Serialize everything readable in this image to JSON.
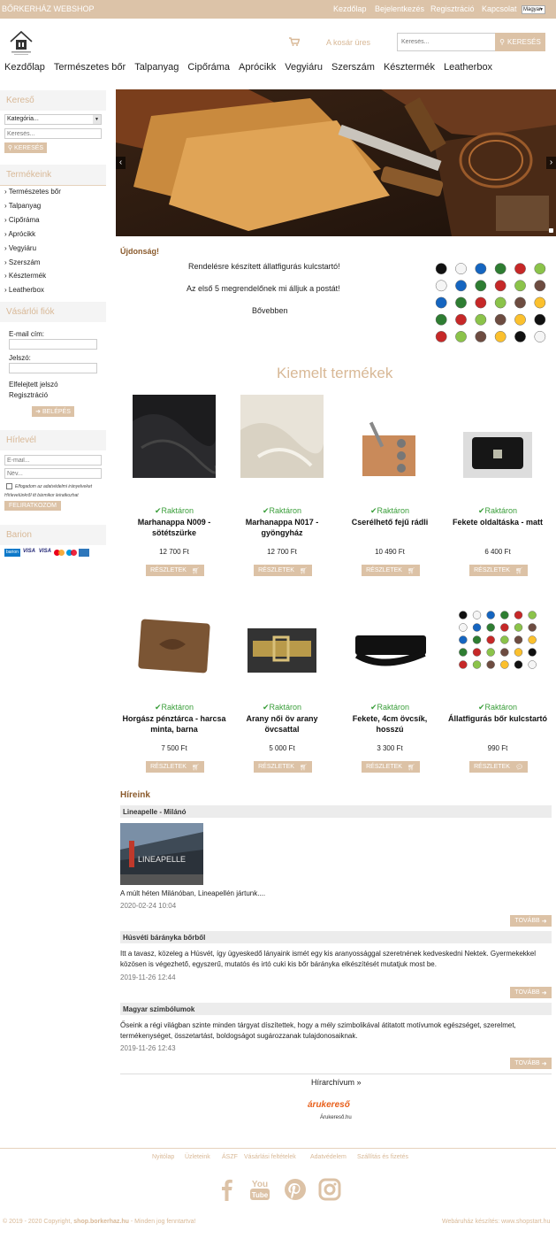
{
  "topbar": {
    "brand": "BŐRKERHÁZ WEBSHOP",
    "links": [
      "Kezdőlap",
      "Bejelentkezés",
      "Regisztráció",
      "Kapcsolat"
    ],
    "language": "Magyar"
  },
  "header": {
    "cart_text": "A kosár üres",
    "search_placeholder": "Keresés...",
    "search_button": "KERESÉS"
  },
  "nav": [
    "Kezdőlap",
    "Természetes bőr",
    "Talpanyag",
    "Cipőráma",
    "Aprócikk",
    "Vegyiáru",
    "Szerszám",
    "Késztermék",
    "Leatherbox"
  ],
  "sidebar": {
    "search_title": "Kereső",
    "category_select": "Kategória...",
    "search_placeholder": "Keresés...",
    "search_button": "KERESÉS",
    "products_title": "Termékeink",
    "categories": [
      "Természetes bőr",
      "Talpanyag",
      "Cipőráma",
      "Aprócikk",
      "Vegyiáru",
      "Szerszám",
      "Késztermék",
      "Leatherbox"
    ],
    "account_title": "Vásárlói fiók",
    "email_label": "E-mail cím:",
    "password_label": "Jelszó:",
    "forgot": "Elfelejtett jelszó",
    "register": "Regisztráció",
    "login_button": "BELÉPÉS",
    "newsletter_title": "Hírlevél",
    "email_placeholder": "E-mail...",
    "name_placeholder": "Név...",
    "consent": "Elfogadom az adatvédelmi irányelveket",
    "unsubscribe": "Hírlevelünkről itt bármikor leiratkozhat",
    "subscribe_button": "FELIRATKOZOM",
    "payment_title": "Barion",
    "payment_logos": [
      "barion",
      "VISA",
      "VISA",
      "mastercard",
      "maestro",
      "amex"
    ]
  },
  "news_banner": {
    "label": "Újdonság!",
    "line1": "Rendelésre készített állatfigurás kulcstartó!",
    "line2": "Az első 5 megrendelőnek mi álljuk a postát!",
    "line3": "Bővebben"
  },
  "featured": {
    "title": "Kiemelt termékek",
    "stock_text": "Raktáron",
    "details_button": "RÉSZLETEK",
    "products": [
      {
        "name": "Marhanappa N009 - sötétszürke",
        "price": "12 700 Ft",
        "img": "black-leather"
      },
      {
        "name": "Marhanappa N017 - gyöngyház",
        "price": "12 700 Ft",
        "img": "cream-leather"
      },
      {
        "name": "Cserélhető fejű rádli",
        "price": "10 490 Ft",
        "img": "tool"
      },
      {
        "name": "Fekete oldaltáska - matt",
        "price": "6 400 Ft",
        "img": "bag"
      },
      {
        "name": "Horgász pénztárca - harcsa minta, barna",
        "price": "7 500 Ft",
        "img": "wallet"
      },
      {
        "name": "Arany női öv arany övcsattal",
        "price": "5 000 Ft",
        "img": "gold-belt"
      },
      {
        "name": "Fekete, 4cm övcsík, hosszú",
        "price": "3 300 Ft",
        "img": "black-belt"
      },
      {
        "name": "Állatfigurás bőr kulcstartó",
        "price": "990 Ft",
        "img": "keychains"
      }
    ]
  },
  "news": {
    "title": "Híreink",
    "more_button": "TOVÁBB",
    "items": [
      {
        "title": "Lineapelle - Milánó",
        "text": "A múlt héten Milánóban, Lineapellén jártunk....",
        "date": "2020-02-24 10:04",
        "image_text": "LINEAPELLE"
      },
      {
        "title": "Húsvéti bárányka bőrből",
        "text": "Itt a tavasz, közeleg a Húsvét, így ügyeskedő lányaink ismét egy kis aranyossággal szeretnének kedveskedni Nektek. Gyermekekkel közösen is végezhető, egyszerű, mutatós és irtó cuki kis bőr bárányka elkészítését mutatjuk most be.",
        "date": "2019-11-26 12:44"
      },
      {
        "title": "Magyar szimbólumok",
        "text": "Őseink a régi világban szinte minden tárgyat díszítettek, hogy a mély szimbolikával átitatott motívumok egészséget, szerelmet, termékenységet, összetartást, boldogságot sugározzanak tulajdonosaiknak.",
        "date": "2019-11-26 12:43"
      }
    ],
    "archive": "Hírarchívum »"
  },
  "arukereso": {
    "logo": "árukereső",
    "label": "Árukereső.hu"
  },
  "footer": {
    "links": [
      "Nyitólap",
      "Üzleteink",
      "ÁSZF",
      "Vásárlási feltételek",
      "Adatvédelem",
      "Szállítás és fizetés"
    ],
    "social": [
      "facebook-icon",
      "youtube-icon",
      "pinterest-icon",
      "instagram-icon"
    ],
    "copyright_prefix": "© 2019 - 2020 Copyright,",
    "copyright_site": "shop.borkerhaz.hu",
    "copyright_suffix": "- Minden jog fenntartva!",
    "credit": "Webáruház készítés: www.shopstart.hu"
  },
  "colors": {
    "accent": "#dcc3a8",
    "stock_green": "#3a9e3a"
  }
}
